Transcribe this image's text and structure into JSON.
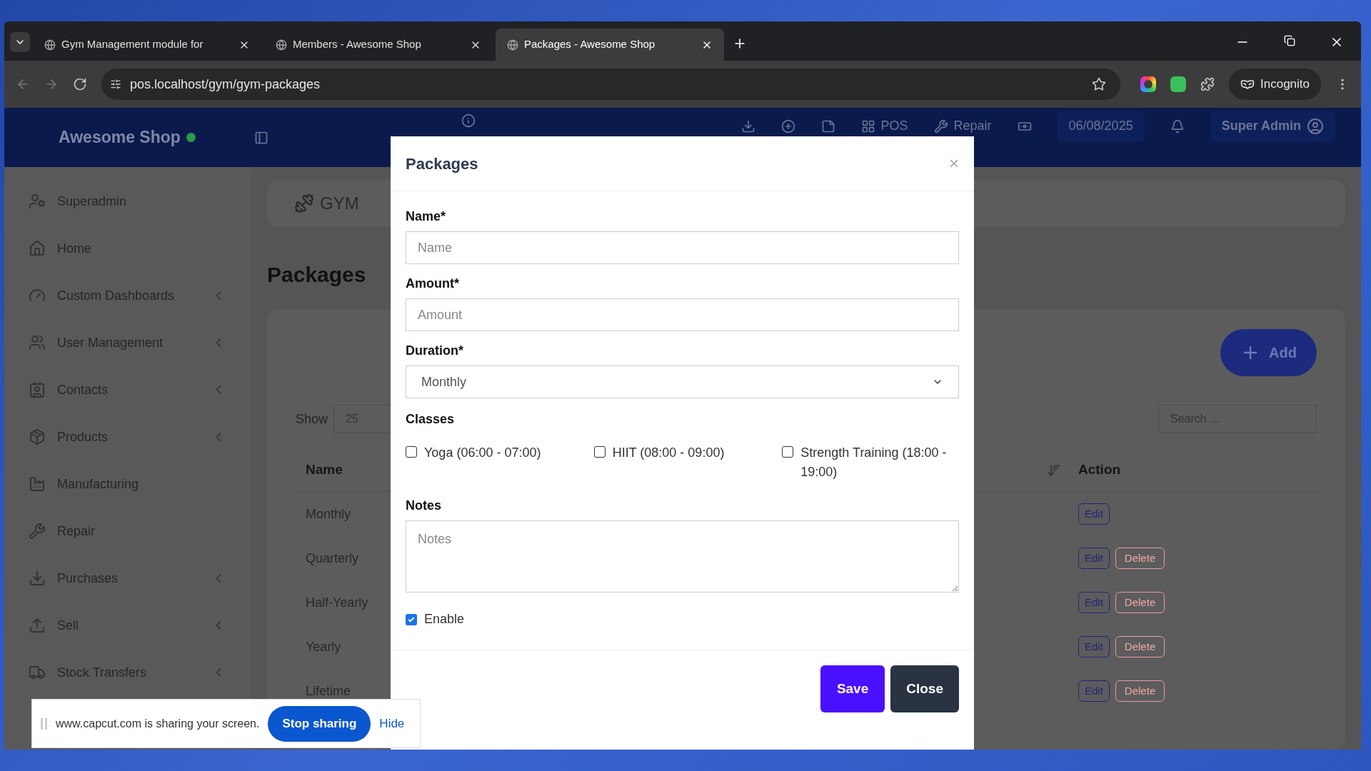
{
  "browser": {
    "tabs": [
      {
        "title": "Gym Management module for",
        "selected": false
      },
      {
        "title": "Members - Awesome Shop",
        "selected": false
      },
      {
        "title": "Packages - Awesome Shop",
        "selected": true
      }
    ],
    "url": "pos.localhost/gym/gym-packages",
    "profile": "Incognito"
  },
  "header": {
    "brand": "Awesome Shop",
    "items": [
      {
        "kind": "icon"
      },
      {
        "kind": "icon"
      },
      {
        "kind": "icon"
      },
      {
        "kind": "text",
        "label": "POS"
      },
      {
        "kind": "text",
        "label": "Repair"
      },
      {
        "kind": "icon"
      },
      {
        "kind": "date",
        "label": "06/08/2025"
      },
      {
        "kind": "icon"
      },
      {
        "kind": "user",
        "label": "Super Admin"
      }
    ]
  },
  "sidebar": {
    "items": [
      {
        "label": "Superadmin",
        "expandable": false
      },
      {
        "label": "Home",
        "expandable": false
      },
      {
        "label": "Custom Dashboards",
        "expandable": true
      },
      {
        "label": "User Management",
        "expandable": true
      },
      {
        "label": "Contacts",
        "expandable": true
      },
      {
        "label": "Products",
        "expandable": true
      },
      {
        "label": "Manufacturing",
        "expandable": false
      },
      {
        "label": "Repair",
        "expandable": false
      },
      {
        "label": "Purchases",
        "expandable": true
      },
      {
        "label": "Sell",
        "expandable": true
      },
      {
        "label": "Stock Transfers",
        "expandable": true
      }
    ]
  },
  "module_nav": {
    "label": "GYM"
  },
  "page": {
    "title": "Packages",
    "add_button": "Add",
    "show_label": "Show",
    "page_size": "25",
    "search": {
      "placeholder": "Search ..."
    },
    "table": {
      "columns": [
        "Name",
        "Action"
      ],
      "rows": [
        {
          "name": "Monthly",
          "actions": [
            "Edit"
          ]
        },
        {
          "name": "Quarterly",
          "actions": [
            "Edit",
            "Delete"
          ]
        },
        {
          "name": "Half-Yearly",
          "actions": [
            "Edit",
            "Delete"
          ]
        },
        {
          "name": "Yearly",
          "actions": [
            "Edit",
            "Delete"
          ]
        },
        {
          "name": "Lifetime",
          "actions": [
            "Edit",
            "Delete"
          ]
        }
      ]
    }
  },
  "modal": {
    "title": "Packages",
    "close": "×",
    "fields": [
      {
        "kind": "input",
        "label": "Name*",
        "placeholder": "Name"
      },
      {
        "kind": "input",
        "label": "Amount*",
        "placeholder": "Amount"
      },
      {
        "kind": "select",
        "label": "Duration*",
        "value": "Monthly"
      }
    ],
    "classes": {
      "label": "Classes",
      "items": [
        {
          "label": "Yoga (06:00 - 07:00)",
          "checked": false
        },
        {
          "label": "HIIT (08:00 - 09:00)",
          "checked": false
        },
        {
          "label": "Strength Training (18:00 - 19:00)",
          "checked": false
        }
      ]
    },
    "notes": {
      "label": "Notes",
      "placeholder": "Notes"
    },
    "enable": {
      "label": "Enable",
      "checked": true
    },
    "buttons": [
      {
        "label": "Save",
        "kind": "primary"
      },
      {
        "label": "Close",
        "kind": "secondary"
      }
    ]
  },
  "share_bar": {
    "message": "www.capcut.com is sharing your screen.",
    "stop": "Stop sharing",
    "hide": "Hide"
  }
}
